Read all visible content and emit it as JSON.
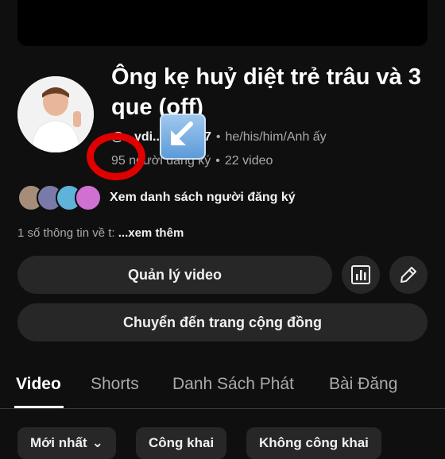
{
  "channel": {
    "title": "Ông kẹ huỷ diệt trẻ trâu và 3 que (off)",
    "handle": "@...ydi...rau5437",
    "pronouns": "he/his/him/Anh ấy",
    "subscribers": "95 người đăng ký",
    "videos": "22 video"
  },
  "subscribers_link": "Xem danh sách người đăng ký",
  "description": {
    "prefix": "1 số thông tin về t: ",
    "more": "...xem thêm"
  },
  "actions": {
    "manage": "Quản lý video",
    "community": "Chuyển đến trang cộng đồng"
  },
  "tabs": [
    "Video",
    "Shorts",
    "Danh Sách Phát",
    "Bài Đăng"
  ],
  "chips": [
    "Mới nhất",
    "Công khai",
    "Không công khai"
  ],
  "icons": {
    "analytics": "bar-chart-icon",
    "edit": "pencil-icon",
    "arrow": "down-left-arrow-icon"
  },
  "colors": {
    "background": "#0f0f0f",
    "surface": "#272727",
    "annotation": "#e10000"
  }
}
